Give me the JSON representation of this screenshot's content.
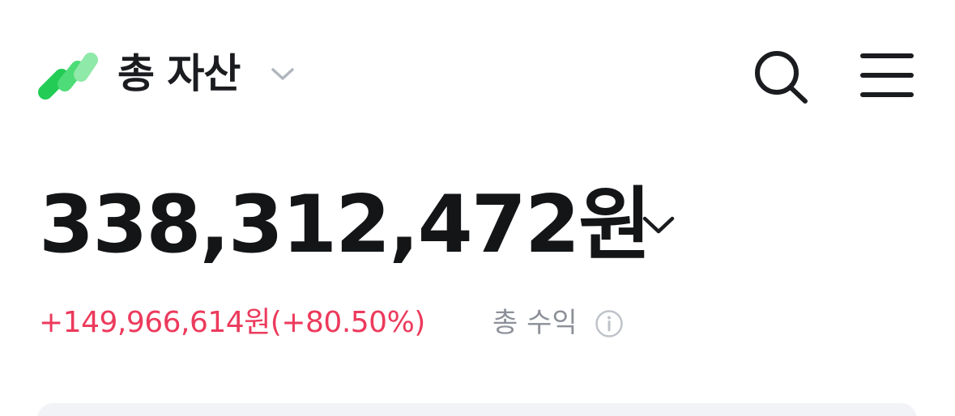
{
  "header": {
    "title": "총 자산",
    "logo_icon": "brand-stripes-logo",
    "title_dropdown_icon": "chevron-down-icon",
    "search_icon": "search-icon",
    "menu_icon": "hamburger-menu-icon"
  },
  "summary": {
    "total_amount": "338,312,472원",
    "total_dropdown_icon": "chevron-down-icon",
    "profit_text": "+149,966,614원(+80.50%)",
    "profit_label": "총 수익",
    "info_icon": "info-icon"
  },
  "colors": {
    "brand_green_dark": "#22cc55",
    "brand_green_mid": "#4ddc77",
    "brand_green_light": "#8fe9a8",
    "profit_red": "#ec3a5c",
    "muted_gray": "#8c9098",
    "text_dark": "#141517"
  }
}
